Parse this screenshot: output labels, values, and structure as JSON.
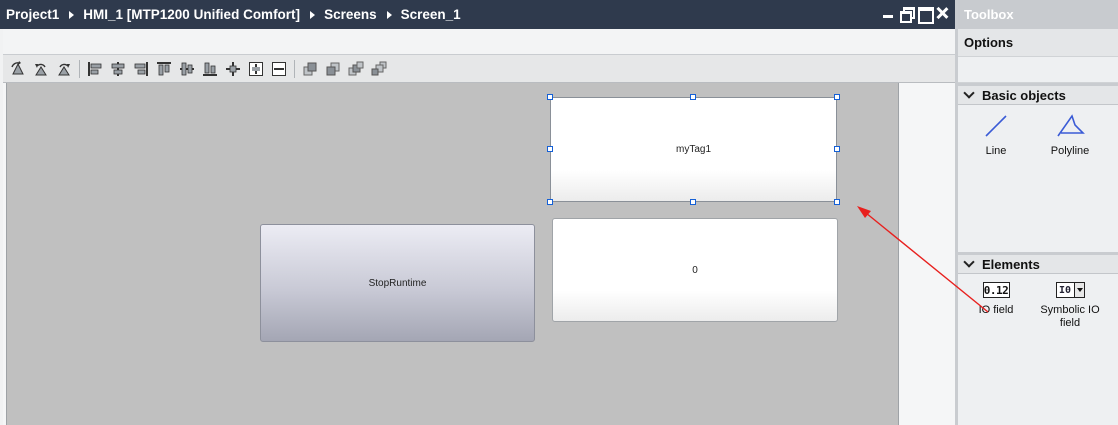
{
  "editor": {
    "breadcrumb": [
      "Project1",
      "HMI_1 [MTP1200 Unified Comfort]",
      "Screens",
      "Screen_1"
    ],
    "window_controls": [
      "minimize-icon",
      "float-icon",
      "maximize-icon",
      "close-icon"
    ]
  },
  "toolbar": {
    "tools": [
      "rotate-left-icon",
      "rotate-ccw-icon",
      "rotate-cw-icon",
      "align-left-icon",
      "align-center-icon",
      "align-right-icon",
      "align-top-icon",
      "align-middle-icon",
      "align-bottom-icon",
      "center-icon",
      "same-width-icon",
      "same-height-icon",
      "bring-to-front-icon",
      "send-to-back-icon",
      "forward-icon",
      "backward-icon"
    ]
  },
  "screen": {
    "tag_field_text": "myTag1",
    "value_field_text": "0",
    "button_text": "StopRuntime"
  },
  "toolbox": {
    "title": "Toolbox",
    "options_label": "Options",
    "basic_objects": {
      "header": "Basic objects",
      "items": [
        {
          "label": "Line",
          "icon": "line-icon"
        },
        {
          "label": "Polyline",
          "icon": "polyline-icon"
        }
      ]
    },
    "elements": {
      "header": "Elements",
      "items": [
        {
          "label": "IO field",
          "icon_text": "0.12",
          "icon": "io-field-icon"
        },
        {
          "label": "Symbolic IO field",
          "icon_text": "I0",
          "icon": "symbolic-io-field-icon"
        }
      ]
    }
  },
  "colors": {
    "titlebar": "#2f3a4d",
    "canvas": "#c0c0c0",
    "selection_handle": "#1560d6",
    "annotation_arrow": "#e8201e"
  }
}
